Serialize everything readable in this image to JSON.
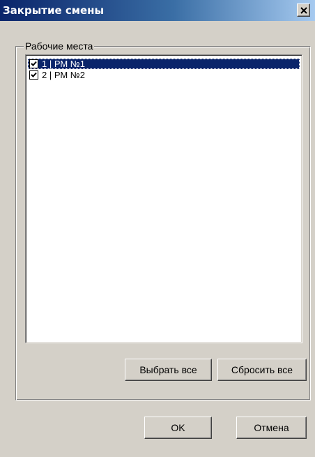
{
  "window": {
    "title": "Закрытие смены",
    "close_symbol": "×",
    "title_gradient": [
      "#0a246a",
      "#a6caf0"
    ]
  },
  "workplaces": {
    "legend": "Рабочие места",
    "items": [
      {
        "label": "1 | РМ №1",
        "checked": true,
        "selected": true
      },
      {
        "label": "2 | РМ №2",
        "checked": true,
        "selected": false
      }
    ]
  },
  "buttons": {
    "select_all": "Выбрать все",
    "reset_all": "Сбросить все",
    "ok": "OK",
    "cancel": "Отмена"
  },
  "colors": {
    "dialog_bg": "#d4d0c8",
    "selection_bg": "#0a246a",
    "selection_text": "#ffffff"
  },
  "icons": {
    "close": "close-icon",
    "check": "checkmark-icon"
  }
}
